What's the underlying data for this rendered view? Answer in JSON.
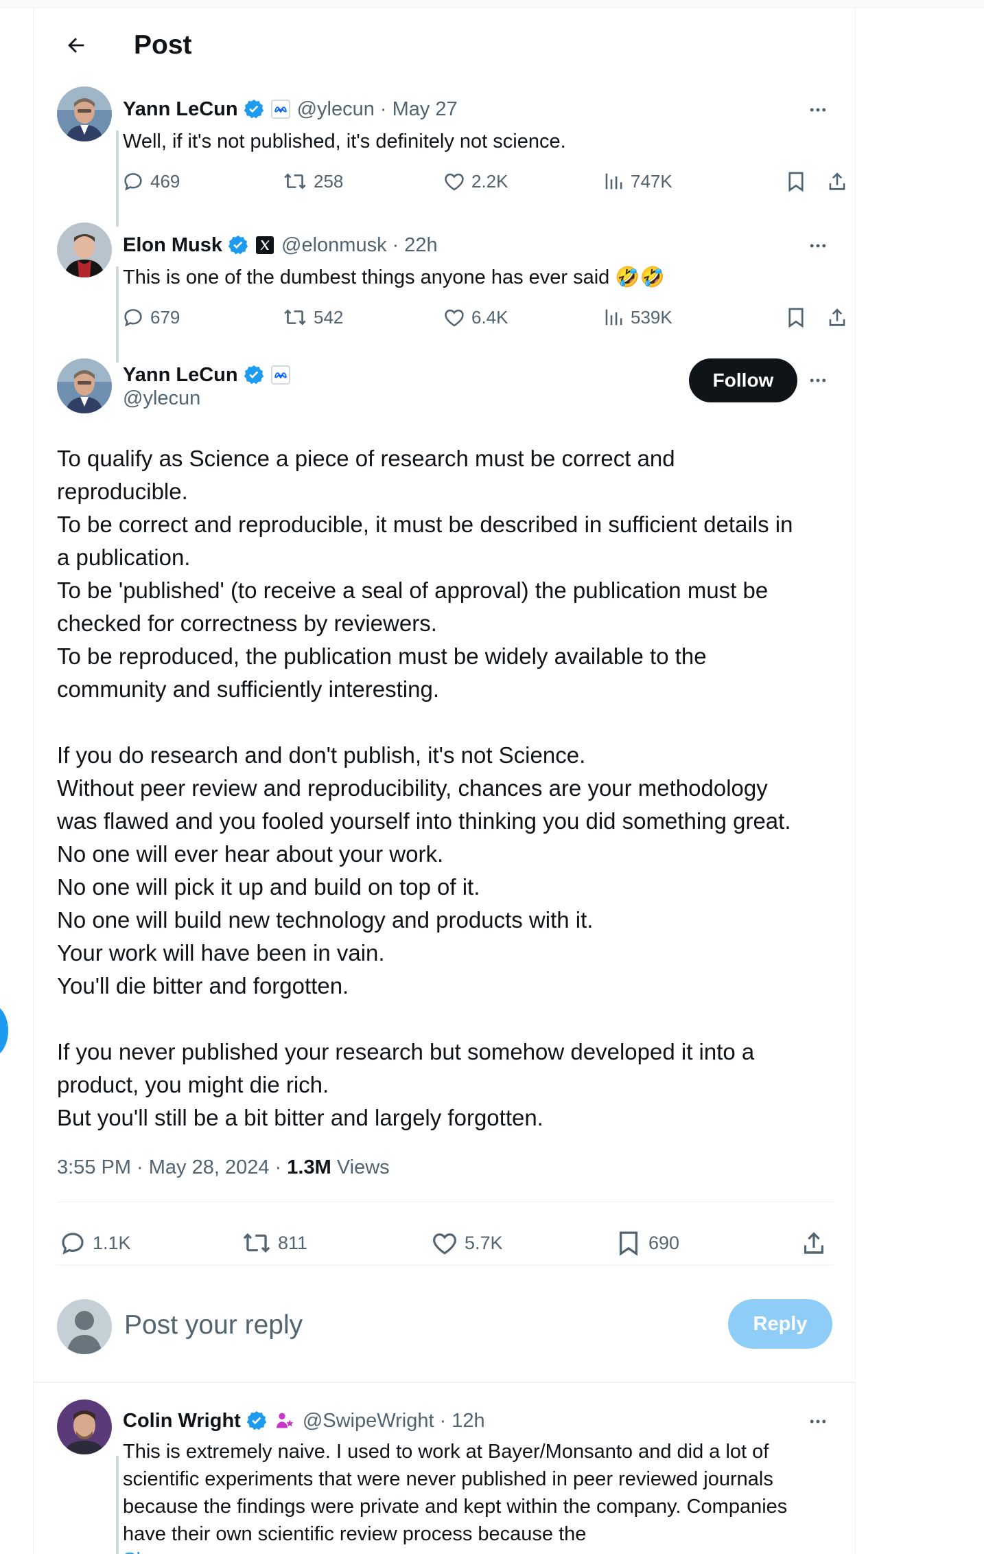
{
  "header": {
    "title": "Post"
  },
  "thread": [
    {
      "name": "Yann LeCun",
      "handle": "@ylecun",
      "time": "· May 27",
      "text": "Well, if it's not published, it's definitely not science.",
      "stats": {
        "replies": "469",
        "reposts": "258",
        "likes": "2.2K",
        "views": "747K"
      }
    },
    {
      "name": "Elon Musk",
      "handle": "@elonmusk",
      "time": "· 22h",
      "text": "This is one of the dumbest things anyone has ever said 🤣🤣",
      "stats": {
        "replies": "679",
        "reposts": "542",
        "likes": "6.4K",
        "views": "539K"
      }
    }
  ],
  "main_post": {
    "name": "Yann LeCun",
    "handle": "@ylecun",
    "follow_label": "Follow",
    "lines": [
      "To qualify as Science a piece of research must be correct and",
      "reproducible.",
      "To be correct and reproducible, it must be described in sufficient details in",
      "a publication.",
      "To be 'published' (to receive a seal of approval) the publication must be",
      "checked for correctness by reviewers.",
      "To be reproduced, the publication must be widely available to the",
      "community and sufficiently interesting.",
      "",
      "If you do research and don't publish, it's not Science.",
      "Without peer review and reproducibility, chances are your methodology",
      "was flawed and you fooled yourself into thinking you did something great.",
      "No one will ever hear about your work.",
      "No one will pick it up and build on top of it.",
      "No one will build new technology and products with it.",
      "Your work will have been in vain.",
      "You'll die bitter and forgotten.",
      "",
      "If you never published your research but somehow developed it into a",
      "product, you might die rich.",
      "But you'll still be a bit bitter and largely forgotten."
    ],
    "timestamp": "3:55 PM · May 28, 2024 · ",
    "views_count": "1.3M",
    "views_label": " Views",
    "stats": {
      "replies": "1.1K",
      "reposts": "811",
      "likes": "5.7K",
      "bookmarks": "690"
    }
  },
  "composer": {
    "placeholder": "Post your reply",
    "button_label": "Reply"
  },
  "reply": {
    "name": "Colin Wright",
    "handle": "@SwipeWright",
    "time": "· 12h",
    "lines": [
      "This is extremely naive. I used to work at Bayer/Monsanto and did a lot of",
      "scientific experiments that were never published in peer reviewed journals",
      "because the findings were private and kept within the company. Companies",
      "have their own scientific review process because the"
    ],
    "show_more": "Show more"
  },
  "colors": {
    "accent": "#1d9bf0",
    "text": "#0f1419",
    "secondary": "#536471",
    "reply_button": "#8ecdf8"
  },
  "icons": [
    "back-arrow-icon",
    "verified-badge-icon",
    "meta-logo-icon",
    "x-logo-icon",
    "more-icon",
    "reply-icon",
    "repost-icon",
    "like-icon",
    "views-icon",
    "bookmark-icon",
    "share-icon",
    "default-avatar-icon",
    "support-badge-icon"
  ]
}
